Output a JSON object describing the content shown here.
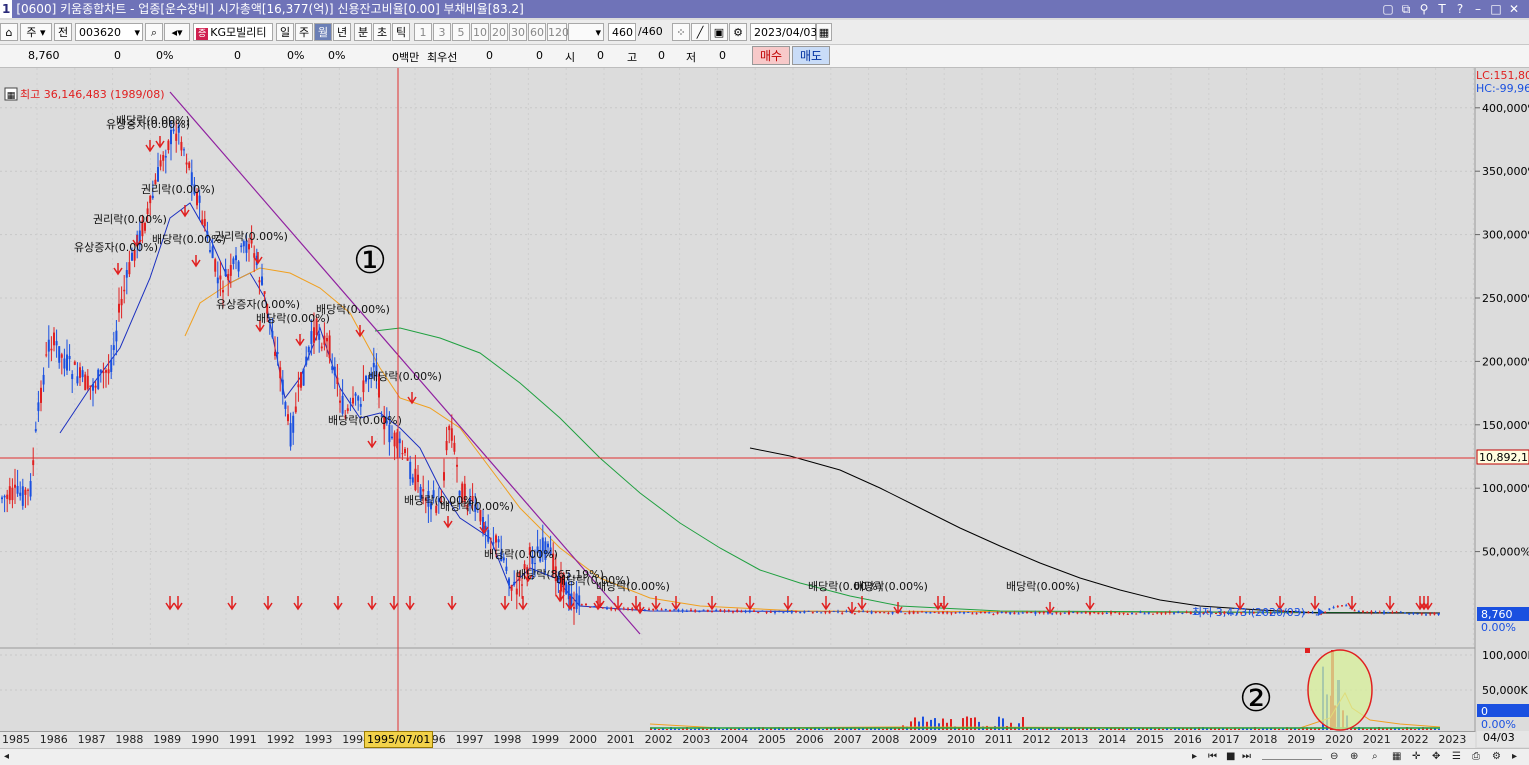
{
  "window": {
    "number": "1",
    "title": "[0600] 키움종합차트 - 업종[운수장비] 시가총액[16,377(억)] 신용잔고비율[0.00] 부채비율[83.2]"
  },
  "toolbar": {
    "period_type": "주",
    "adjust": "전",
    "stock_code": "003620",
    "stock_badge": "증",
    "stock_name": "KG모빌리티",
    "periods": [
      "일",
      "주",
      "월",
      "년",
      "분",
      "초",
      "틱"
    ],
    "selected_period": "월",
    "intervals": [
      "1",
      "3",
      "5",
      "10",
      "20",
      "30",
      "60",
      "120"
    ],
    "count": "460",
    "count_total": "/460",
    "date": "2023/04/03"
  },
  "quote": {
    "price": "8,760",
    "change": "0",
    "change_pct": "0%",
    "volume": "0",
    "volume_pct": "0%",
    "other_pct": "0%",
    "trade_amount": "0백만",
    "best_bid_label": "최우선",
    "best_bid_1": "0",
    "best_bid_2": "0",
    "open_label": "시",
    "open": "0",
    "high_label": "고",
    "high": "0",
    "low_label": "저",
    "low": "0",
    "buy_label": "매수",
    "sell_label": "매도"
  },
  "chart": {
    "high_note": "최고 36,146,483 (1989/08)",
    "low_note": "최저 3,473 (2020/03)",
    "circle_labels": [
      "①",
      "②"
    ],
    "lc_label": "LC:151,80",
    "hc_label": "HC:-99,96",
    "cursor_value": "10,892,11",
    "last_price": "8,760",
    "last_pct": "0.00%",
    "vol_last": "0",
    "vol_last_pct": "0.00%",
    "y_ticks": [
      "400,000%",
      "350,000%",
      "300,000%",
      "250,000%",
      "200,000%",
      "150,000%",
      "100,000%",
      "50,000%"
    ],
    "vol_ticks": [
      "100,000K",
      "50,000K"
    ],
    "x_years": [
      "1985",
      "1986",
      "1987",
      "1988",
      "1989",
      "1990",
      "1991",
      "1992",
      "1993",
      "1994",
      "1995",
      "1996",
      "1997",
      "1998",
      "1999",
      "2000",
      "2001",
      "2002",
      "2003",
      "2004",
      "2005",
      "2006",
      "2007",
      "2008",
      "2009",
      "2010",
      "2011",
      "2012",
      "2013",
      "2014",
      "2015",
      "2016",
      "2017",
      "2018",
      "2019",
      "2020",
      "2021",
      "2022",
      "2023"
    ],
    "cursor_date": "1995/07/01",
    "right_date": "04/03",
    "events": [
      {
        "label": "유상증자(0.00%)"
      },
      {
        "label": "배당락(0.00%)"
      },
      {
        "label": "권리락(0.00%)"
      },
      {
        "label": "권리락(0.00%)"
      },
      {
        "label": "유상증자(0.00%)"
      },
      {
        "label": "배당락(0.00%)"
      },
      {
        "label": "권리락(0.00%)"
      },
      {
        "label": "유상증자(0.00%)"
      },
      {
        "label": "배당락(0.00%)"
      },
      {
        "label": "배당락(0.00%)"
      },
      {
        "label": "배당락(0.00%)"
      },
      {
        "label": "배당락(0.00%)"
      },
      {
        "label": "배당락(0.00%)"
      },
      {
        "label": "배당락(0.00%)"
      },
      {
        "label": "배당락(0.00%)"
      },
      {
        "label": "배당락(0.00%)"
      },
      {
        "label": "배당락(865.19%)"
      },
      {
        "label": "배당락(0.00%)"
      },
      {
        "label": "배당락(0.00%)"
      },
      {
        "label": "배당락(0.00%)"
      },
      {
        "label": "배당락(0.00%)"
      }
    ]
  },
  "colors": {
    "up": "#e02020",
    "down": "#1a50e0",
    "ma_fast": "#1a2fc0",
    "ma_mid": "#f0a020",
    "ma_slow": "#20a040",
    "ma_long": "#000000",
    "trend": "#9020a0"
  }
}
